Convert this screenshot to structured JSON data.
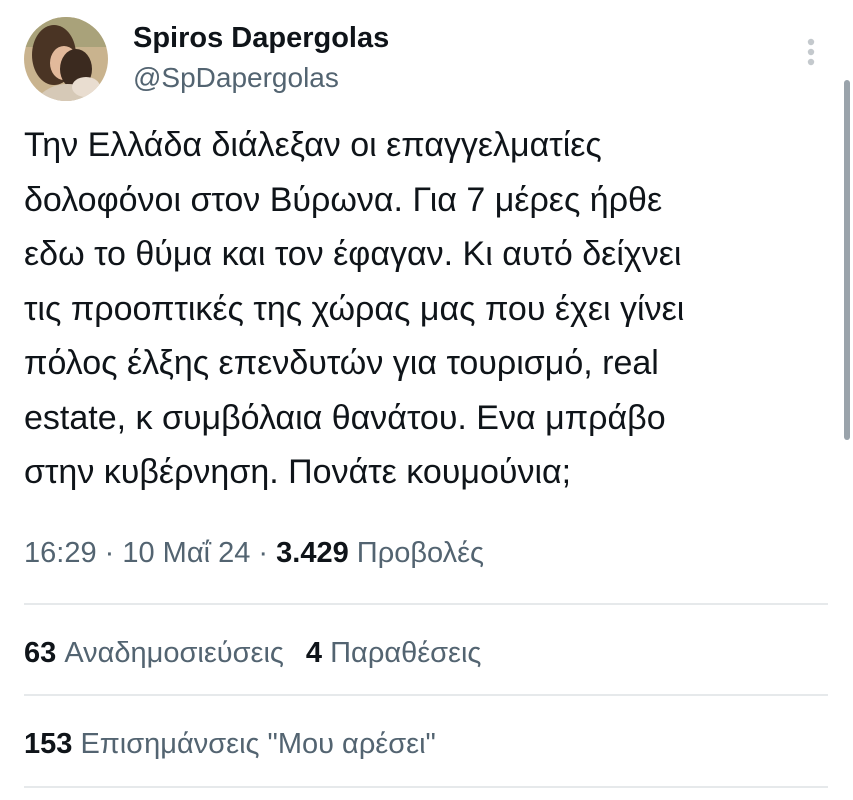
{
  "author": {
    "name": "Spiros Dapergolas",
    "handle": "@SpDapergolas"
  },
  "tweet": {
    "text": "Την Ελλάδα διάλεξαν οι επαγγελματίες\nδολοφόνοι στον Βύρωνα. Για 7 μέρες ήρθε\nεδω το θύμα και τον έφαγαν. Κι αυτό δείχνει\nτις προοπτικές της χώρας μας που έχει γίνει\nπόλος έλξης επενδυτών για τουρισμό, real\nestate, κ συμβόλαια θανάτου. Ενα μπράβο\nστην κυβέρνηση. Πονάτε κουμούνια;"
  },
  "meta": {
    "time": "16:29",
    "separator1": " · ",
    "date": "10 Μαΐ 24",
    "separator2": " · ",
    "views_count": "3.429",
    "views_label": "Προβολές"
  },
  "stats": {
    "reposts_count": "63",
    "reposts_label": "Αναδημοσιεύσεις",
    "quotes_count": "4",
    "quotes_label": "Παραθέσεις",
    "likes_count": "153",
    "likes_label": "Επισημάνσεις \"Μου αρέσει\""
  },
  "icons": {
    "more": "more-vertical-icon"
  },
  "colors": {
    "text_primary": "#0f1419",
    "text_secondary": "#536471",
    "divider": "#e6e9eb"
  }
}
